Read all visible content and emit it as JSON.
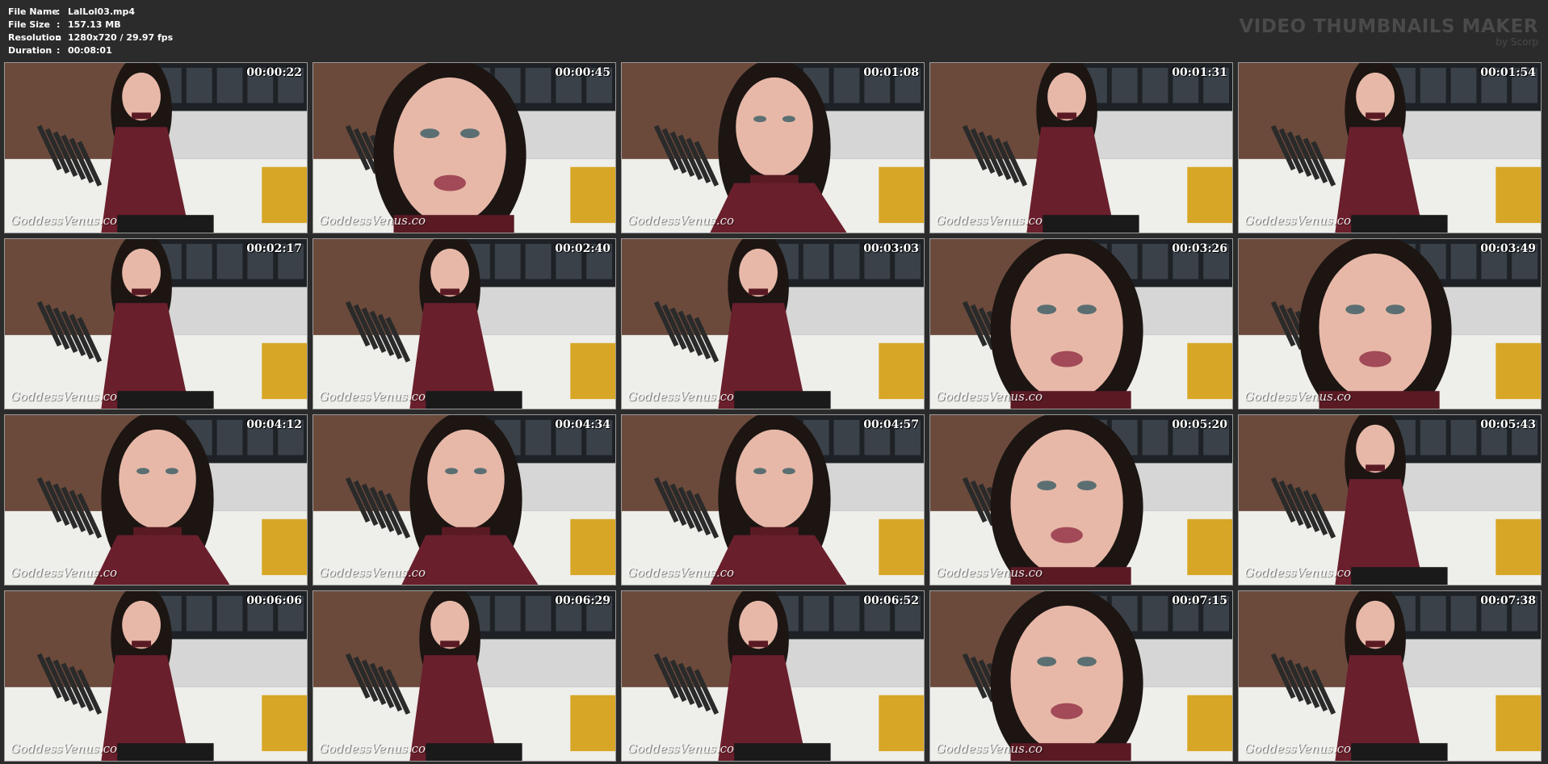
{
  "info": {
    "rows": [
      {
        "key": "File Name",
        "sep": ":",
        "value": "LalLol03.mp4"
      },
      {
        "key": "File Size",
        "sep": ":",
        "value": "157.13 MB"
      },
      {
        "key": "Resolution",
        "sep": ":",
        "value": "1280x720 / 29.97 fps"
      },
      {
        "key": "Duration",
        "sep": ":",
        "value": "00:08:01"
      }
    ]
  },
  "brand": {
    "title": "VIDEO THUMBNAILS MAKER",
    "subtitle": "by Scorp"
  },
  "watermark": "GoddessVenus.co",
  "thumbnails": [
    {
      "time": "00:00:22",
      "shot": "wide"
    },
    {
      "time": "00:00:45",
      "shot": "close"
    },
    {
      "time": "00:01:08",
      "shot": "medium"
    },
    {
      "time": "00:01:31",
      "shot": "wide"
    },
    {
      "time": "00:01:54",
      "shot": "wide"
    },
    {
      "time": "00:02:17",
      "shot": "wide"
    },
    {
      "time": "00:02:40",
      "shot": "wide"
    },
    {
      "time": "00:03:03",
      "shot": "wide"
    },
    {
      "time": "00:03:26",
      "shot": "close"
    },
    {
      "time": "00:03:49",
      "shot": "close"
    },
    {
      "time": "00:04:12",
      "shot": "medium"
    },
    {
      "time": "00:04:34",
      "shot": "medium"
    },
    {
      "time": "00:04:57",
      "shot": "medium"
    },
    {
      "time": "00:05:20",
      "shot": "close"
    },
    {
      "time": "00:05:43",
      "shot": "wide"
    },
    {
      "time": "00:06:06",
      "shot": "wide"
    },
    {
      "time": "00:06:29",
      "shot": "wide"
    },
    {
      "time": "00:06:52",
      "shot": "wide"
    },
    {
      "time": "00:07:15",
      "shot": "close"
    },
    {
      "time": "00:07:38",
      "shot": "wide"
    }
  ]
}
